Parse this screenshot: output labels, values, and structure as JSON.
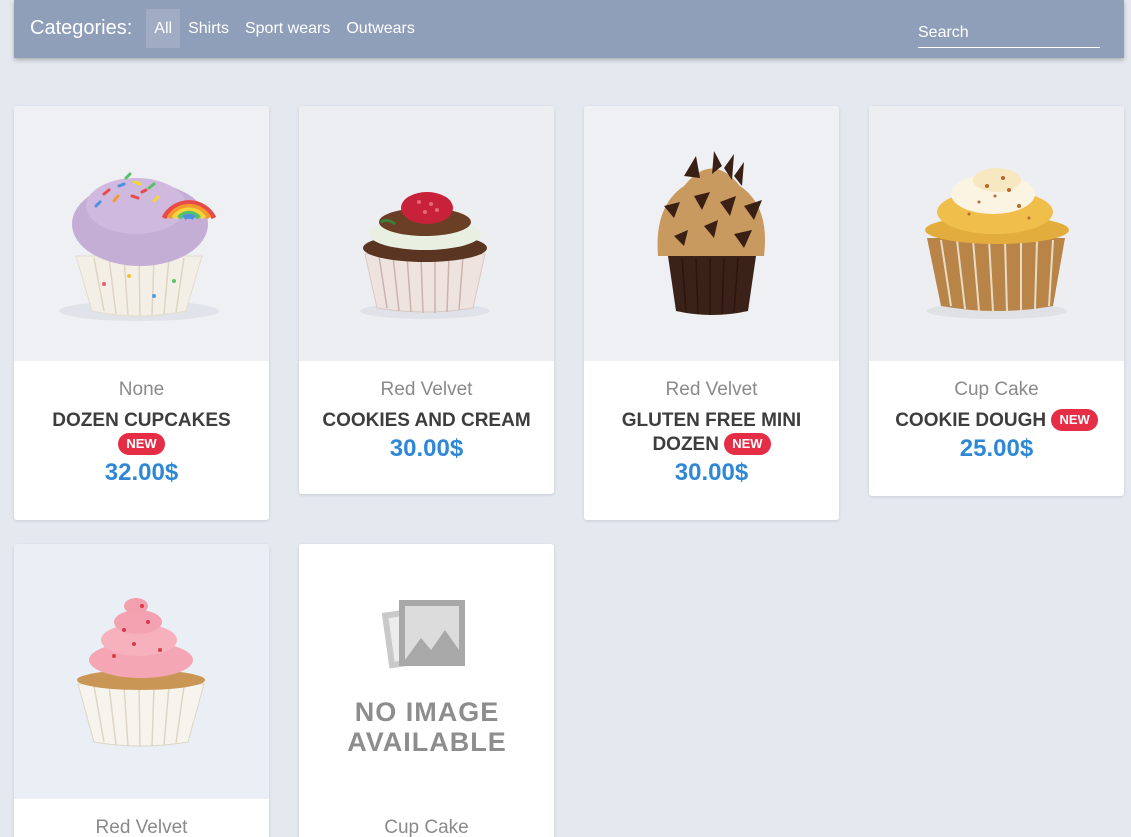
{
  "header": {
    "categories_label": "Categories:",
    "categories": [
      "All",
      "Shirts",
      "Sport wears",
      "Outwears"
    ],
    "active_category": "All",
    "search_placeholder": "Search"
  },
  "products": [
    {
      "category": "None",
      "name": "DOZEN CUPCAKES",
      "is_new": true,
      "badge": "NEW",
      "price": "32.00$",
      "image": "rainbow-cupcake"
    },
    {
      "category": "Red Velvet",
      "name": "COOKIES AND CREAM",
      "is_new": false,
      "price": "30.00$",
      "image": "raspberry-cupcake"
    },
    {
      "category": "Red Velvet",
      "name": "GLUTEN FREE MINI DOZEN",
      "is_new": true,
      "badge": "NEW",
      "price": "30.00$",
      "image": "chocolate-cupcake"
    },
    {
      "category": "Cup Cake",
      "name": "COOKIE DOUGH",
      "is_new": true,
      "badge": "NEW",
      "price": "25.00$",
      "image": "caramel-cupcake"
    },
    {
      "category": "Red Velvet",
      "image": "pink-cupcake"
    },
    {
      "category": "Cup Cake",
      "image": "no-image",
      "placeholder_text": [
        "NO IMAGE",
        "AVAILABLE"
      ]
    }
  ],
  "colors": {
    "header_bg": "#8f9eb9",
    "page_bg": "#e4e8ef",
    "price": "#2f88d6",
    "badge": "#e62d46"
  }
}
